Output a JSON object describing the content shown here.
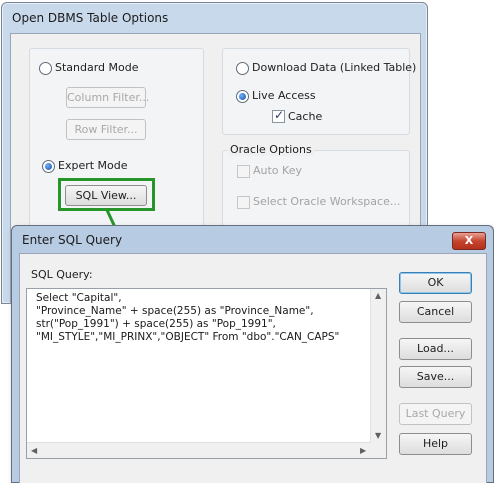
{
  "back_dialog": {
    "title": "Open DBMS Table Options",
    "standard_mode": "Standard Mode",
    "column_filter": "Column Filter...",
    "row_filter": "Row Filter...",
    "expert_mode": "Expert Mode",
    "sql_view": "SQL View...",
    "download_data": "Download Data (Linked Table)",
    "live_access": "Live Access",
    "cache": "Cache",
    "oracle_options": "Oracle Options",
    "auto_key": "Auto Key",
    "select_workspace": "Select Oracle Workspace..."
  },
  "front_dialog": {
    "title": "Enter SQL Query",
    "close": "X",
    "sql_query_label": "SQL Query:",
    "sql_text": "Select \"Capital\",\n\"Province_Name\" + space(255) as \"Province_Name\",\nstr(\"Pop_1991\") + space(255) as \"Pop_1991\",\n\"MI_STYLE\",\"MI_PRINX\",\"OBJECT\" From \"dbo\".\"CAN_CAPS\"",
    "ok": "OK",
    "cancel": "Cancel",
    "load": "Load...",
    "save": "Save...",
    "last_query": "Last Query",
    "help": "Help"
  },
  "colors": {
    "highlight": "#27962a",
    "arrow": "#27962a"
  }
}
